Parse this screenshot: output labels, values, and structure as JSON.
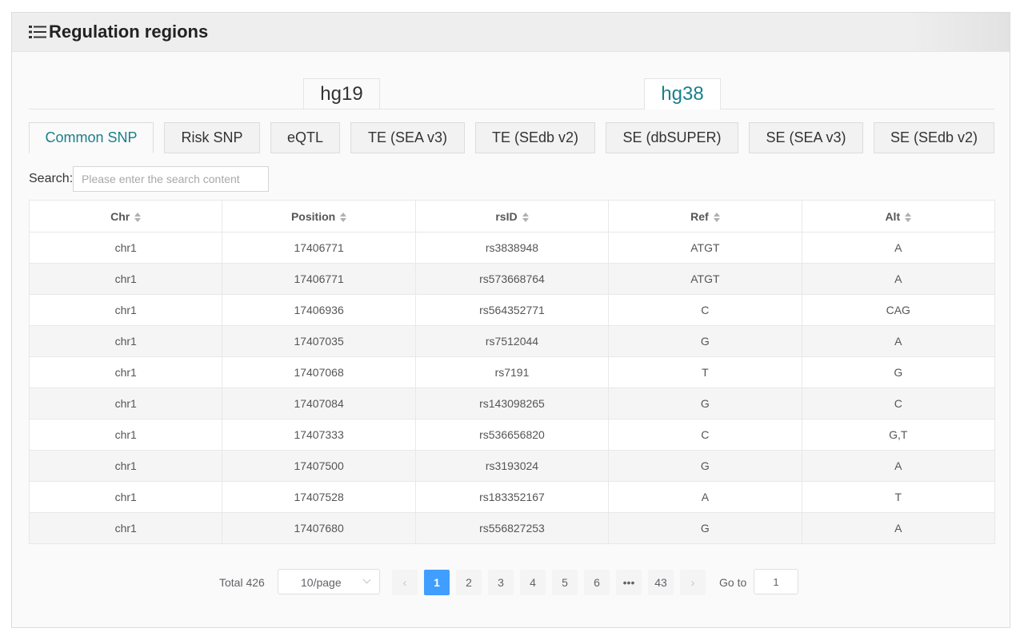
{
  "header": {
    "title": "Regulation regions",
    "icon": "list-icon"
  },
  "assembly_tabs": [
    {
      "label": "hg19",
      "active": false
    },
    {
      "label": "hg38",
      "active": true
    }
  ],
  "sub_tabs": [
    {
      "label": "Common SNP",
      "active": true
    },
    {
      "label": "Risk SNP",
      "active": false
    },
    {
      "label": "eQTL",
      "active": false
    },
    {
      "label": "TE (SEA v3)",
      "active": false
    },
    {
      "label": "TE (SEdb v2)",
      "active": false
    },
    {
      "label": "SE (dbSUPER)",
      "active": false
    },
    {
      "label": "SE (SEA v3)",
      "active": false
    },
    {
      "label": "SE (SEdb v2)",
      "active": false
    }
  ],
  "search": {
    "label": "Search:",
    "placeholder": "Please enter the search content",
    "value": ""
  },
  "table": {
    "columns": [
      "Chr",
      "Position",
      "rsID",
      "Ref",
      "Alt"
    ],
    "rows": [
      [
        "chr1",
        "17406771",
        "rs3838948",
        "ATGT",
        "A"
      ],
      [
        "chr1",
        "17406771",
        "rs573668764",
        "ATGT",
        "A"
      ],
      [
        "chr1",
        "17406936",
        "rs564352771",
        "C",
        "CAG"
      ],
      [
        "chr1",
        "17407035",
        "rs7512044",
        "G",
        "A"
      ],
      [
        "chr1",
        "17407068",
        "rs7191",
        "T",
        "G"
      ],
      [
        "chr1",
        "17407084",
        "rs143098265",
        "G",
        "C"
      ],
      [
        "chr1",
        "17407333",
        "rs536656820",
        "C",
        "G,T"
      ],
      [
        "chr1",
        "17407500",
        "rs3193024",
        "G",
        "A"
      ],
      [
        "chr1",
        "17407528",
        "rs183352167",
        "A",
        "T"
      ],
      [
        "chr1",
        "17407680",
        "rs556827253",
        "G",
        "A"
      ]
    ]
  },
  "pagination": {
    "total_label": "Total 426",
    "page_size": "10/page",
    "pages": [
      "1",
      "2",
      "3",
      "4",
      "5",
      "6",
      "•••",
      "43"
    ],
    "current_page": "1",
    "goto_label": "Go to",
    "goto_value": "1"
  },
  "colors": {
    "accent": "#1a7f8a",
    "pager_active": "#409eff"
  }
}
